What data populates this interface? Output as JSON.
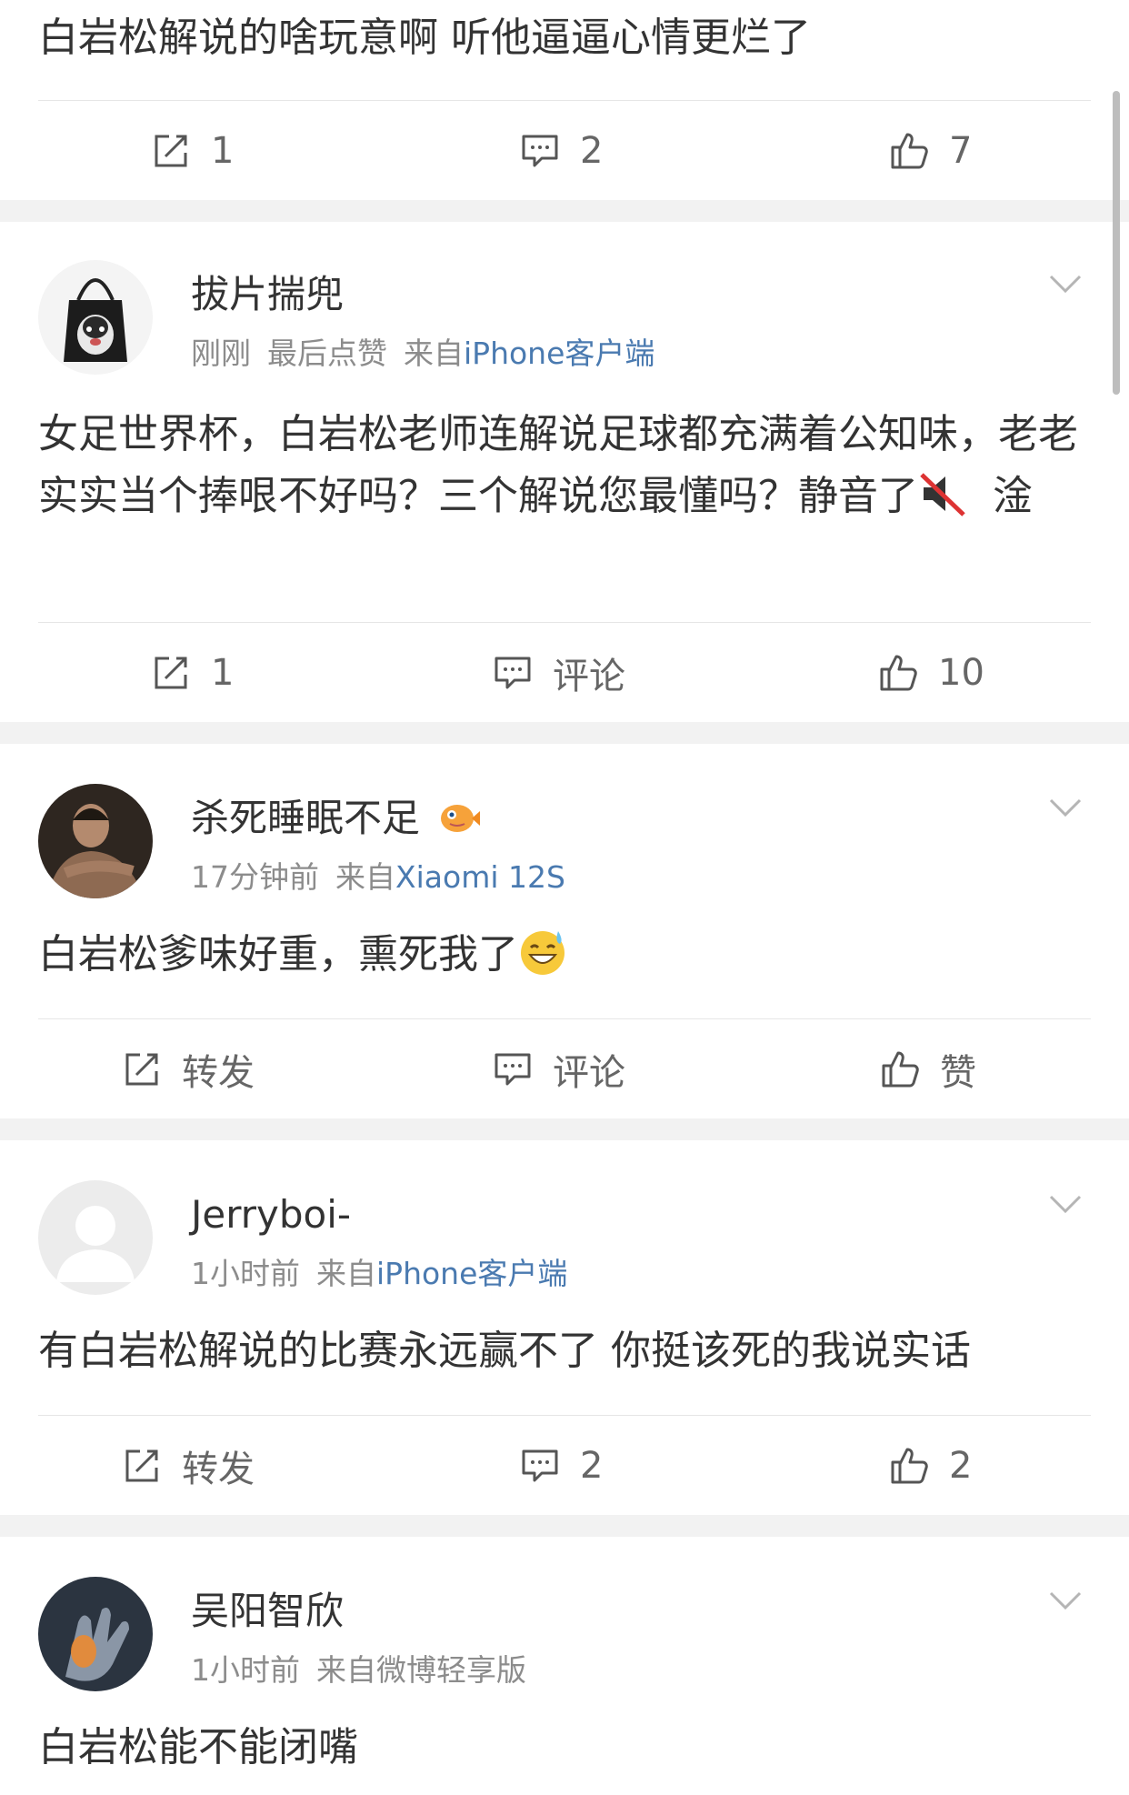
{
  "posts": [
    {
      "content": "白岩松解说的啥玩意啊 听他逼逼心情更烂了",
      "actions": {
        "repost": "1",
        "comment": "2",
        "like": "7"
      }
    },
    {
      "username": "拔片揣兜",
      "time": "刚刚",
      "extra": "最后点赞",
      "source_prefix": "来自",
      "source": "iPhone客户端",
      "content": "女足世界杯，白岩松老师连解说足球都充满着公知味，老老实实当个捧哏不好吗？三个解说您最懂吗？静音了",
      "content_tail": "淦",
      "actions": {
        "repost": "1",
        "comment": "评论",
        "like": "10"
      }
    },
    {
      "username": "杀死睡眠不足",
      "time": "17分钟前",
      "source_prefix": "来自",
      "source": "Xiaomi 12S",
      "content": "白岩松爹味好重，熏死我了",
      "actions": {
        "repost": "转发",
        "comment": "评论",
        "like": "赞"
      }
    },
    {
      "username": "Jerryboi-",
      "time": "1小时前",
      "source_prefix": "来自",
      "source": "iPhone客户端",
      "content": "有白岩松解说的比赛永远赢不了 你挺该死的我说实话",
      "actions": {
        "repost": "转发",
        "comment": "2",
        "like": "2"
      }
    },
    {
      "username": "吴阳智欣",
      "time": "1小时前",
      "source_prefix": "来自",
      "source": "微博轻享版",
      "content": "白岩松能不能闭嘴"
    }
  ],
  "icons": {
    "repost": "repost-icon",
    "comment": "comment-icon",
    "like": "thumbs-up-icon",
    "more": "chevron-down-icon",
    "mute": "muted-speaker-emoji",
    "sweat": "sweat-smile-emoji",
    "badge": "pufferfish-badge"
  },
  "colors": {
    "source_link": "#4a7ab0",
    "meta": "#8c8c8c",
    "text": "#333333",
    "separator": "#f2f2f2"
  }
}
